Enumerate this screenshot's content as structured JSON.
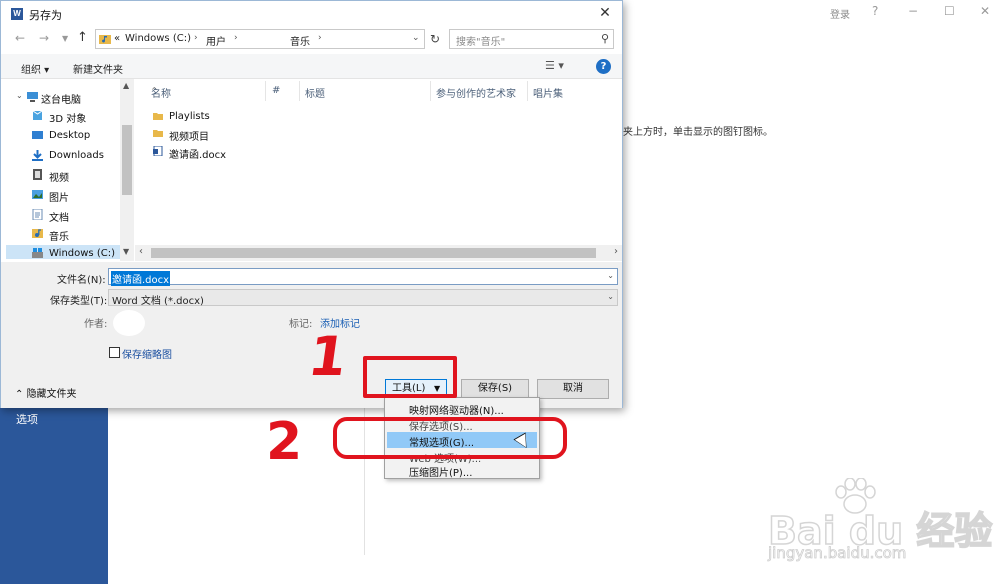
{
  "background": {
    "login": "登录",
    "help": "?",
    "minimize": "−",
    "restore": "☐",
    "close": "✕",
    "hint": "夹上方时，单击显示的图钉图标。",
    "options": "选项"
  },
  "dialog": {
    "title": "另存为",
    "close": "✕",
    "address": {
      "crumbs": [
        "Windows (C:)",
        "用户",
        "音乐"
      ],
      "leading": "«"
    },
    "search_placeholder": "搜索\"音乐\"",
    "toolbar": {
      "organize": "组织 ▾",
      "new_folder": "新建文件夹"
    },
    "nav": {
      "items": [
        "这台电脑",
        "3D 对象",
        "Desktop",
        "Downloads",
        "视频",
        "图片",
        "文档",
        "音乐",
        "Windows (C:)"
      ]
    },
    "columns": [
      "名称",
      "#",
      "标题",
      "参与创作的艺术家",
      "唱片集"
    ],
    "files": [
      {
        "name": "Playlists",
        "type": "folder"
      },
      {
        "name": "视频项目",
        "type": "folder"
      },
      {
        "name": "邀请函.docx",
        "type": "docx"
      }
    ],
    "form": {
      "filename_label": "文件名(N):",
      "filename_value": "邀请函.docx",
      "filetype_label": "保存类型(T):",
      "filetype_value": "Word 文档 (*.docx)",
      "author_label": "作者:",
      "tags_label": "标记:",
      "tags_link": "添加标记",
      "thumbnail_label": "保存缩略图",
      "thumbnail_checked": false,
      "hide_folders": "隐藏文件夹"
    },
    "buttons": {
      "tools": "工具(L)",
      "save": "保存(S)",
      "cancel": "取消"
    }
  },
  "menu": {
    "items": [
      {
        "label": "映射网络驱动器(N)...",
        "highlighted": false
      },
      {
        "label": "保存选项(S)...",
        "highlighted": false
      },
      {
        "label": "常规选项(G)...",
        "highlighted": true
      },
      {
        "label": "Web 选项(W)...",
        "highlighted": false
      },
      {
        "label": "压缩图片(P)...",
        "highlighted": false
      }
    ]
  },
  "annotations": {
    "step1": "1",
    "step2": "2",
    "color": "#e0141e"
  },
  "watermark": {
    "main": "Bai du 经验",
    "sub": "jingyan.baidu.com"
  }
}
